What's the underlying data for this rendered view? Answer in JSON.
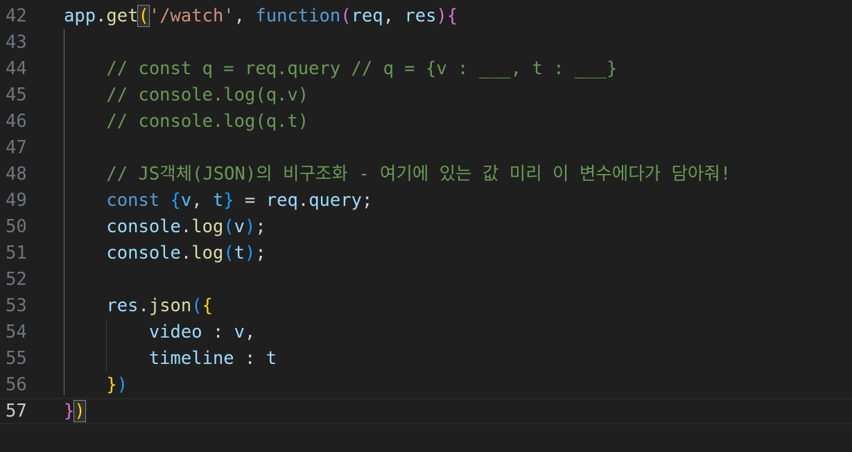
{
  "editor": {
    "language": "javascript",
    "current_line": "57",
    "lines": [
      {
        "num": "42",
        "parts": [
          {
            "t": "app",
            "c": "var"
          },
          {
            "t": ".",
            "c": "pun"
          },
          {
            "t": "get",
            "c": "fn"
          },
          {
            "t": "(",
            "c": "b1",
            "m": true
          },
          {
            "t": "'/watch'",
            "c": "str"
          },
          {
            "t": ", ",
            "c": "pun"
          },
          {
            "t": "function",
            "c": "kw"
          },
          {
            "t": "(",
            "c": "b2"
          },
          {
            "t": "req",
            "c": "var"
          },
          {
            "t": ", ",
            "c": "pun"
          },
          {
            "t": "res",
            "c": "var"
          },
          {
            "t": ")",
            "c": "b2"
          },
          {
            "t": "{",
            "c": "b2"
          }
        ]
      },
      {
        "num": "43",
        "parts": []
      },
      {
        "num": "44",
        "parts": [
          {
            "t": "    // const q = req.query // q = {v : ___, t : ___}",
            "c": "cmt"
          }
        ]
      },
      {
        "num": "45",
        "parts": [
          {
            "t": "    // console.log(q.v)",
            "c": "cmt"
          }
        ]
      },
      {
        "num": "46",
        "parts": [
          {
            "t": "    // console.log(q.t)",
            "c": "cmt"
          }
        ]
      },
      {
        "num": "47",
        "parts": []
      },
      {
        "num": "48",
        "parts": [
          {
            "t": "    // JS객체(JSON)의 비구조화 - 여기에 있는 값 미리 이 변수에다가 담아줘!",
            "c": "cmt"
          }
        ]
      },
      {
        "num": "49",
        "parts": [
          {
            "t": "    ",
            "c": "pun"
          },
          {
            "t": "const",
            "c": "kw"
          },
          {
            "t": " ",
            "c": "pun"
          },
          {
            "t": "{",
            "c": "b3"
          },
          {
            "t": "v",
            "c": "cst"
          },
          {
            "t": ", ",
            "c": "pun"
          },
          {
            "t": "t",
            "c": "cst"
          },
          {
            "t": "}",
            "c": "b3"
          },
          {
            "t": " = ",
            "c": "pun"
          },
          {
            "t": "req",
            "c": "var"
          },
          {
            "t": ".",
            "c": "pun"
          },
          {
            "t": "query",
            "c": "var"
          },
          {
            "t": ";",
            "c": "pun"
          }
        ]
      },
      {
        "num": "50",
        "parts": [
          {
            "t": "    ",
            "c": "pun"
          },
          {
            "t": "console",
            "c": "var"
          },
          {
            "t": ".",
            "c": "pun"
          },
          {
            "t": "log",
            "c": "fn"
          },
          {
            "t": "(",
            "c": "b3"
          },
          {
            "t": "v",
            "c": "var"
          },
          {
            "t": ")",
            "c": "b3"
          },
          {
            "t": ";",
            "c": "pun"
          }
        ]
      },
      {
        "num": "51",
        "parts": [
          {
            "t": "    ",
            "c": "pun"
          },
          {
            "t": "console",
            "c": "var"
          },
          {
            "t": ".",
            "c": "pun"
          },
          {
            "t": "log",
            "c": "fn"
          },
          {
            "t": "(",
            "c": "b3"
          },
          {
            "t": "t",
            "c": "var"
          },
          {
            "t": ")",
            "c": "b3"
          },
          {
            "t": ";",
            "c": "pun"
          }
        ]
      },
      {
        "num": "52",
        "parts": []
      },
      {
        "num": "53",
        "parts": [
          {
            "t": "    ",
            "c": "pun"
          },
          {
            "t": "res",
            "c": "var"
          },
          {
            "t": ".",
            "c": "pun"
          },
          {
            "t": "json",
            "c": "fn"
          },
          {
            "t": "(",
            "c": "b3"
          },
          {
            "t": "{",
            "c": "b1"
          }
        ]
      },
      {
        "num": "54",
        "parts": [
          {
            "t": "        ",
            "c": "pun"
          },
          {
            "t": "video",
            "c": "var"
          },
          {
            "t": " : ",
            "c": "pun"
          },
          {
            "t": "v",
            "c": "var"
          },
          {
            "t": ",",
            "c": "pun"
          }
        ]
      },
      {
        "num": "55",
        "parts": [
          {
            "t": "        ",
            "c": "pun"
          },
          {
            "t": "timeline",
            "c": "var"
          },
          {
            "t": " : ",
            "c": "pun"
          },
          {
            "t": "t",
            "c": "var"
          }
        ]
      },
      {
        "num": "56",
        "parts": [
          {
            "t": "    ",
            "c": "pun"
          },
          {
            "t": "}",
            "c": "b1"
          },
          {
            "t": ")",
            "c": "b3"
          }
        ]
      },
      {
        "num": "57",
        "parts": [
          {
            "t": "}",
            "c": "b2"
          },
          {
            "t": ")",
            "c": "b1",
            "m": true
          }
        ]
      }
    ]
  },
  "colors": {
    "background": "#1f1f1f",
    "line_number": "#6e7681",
    "line_number_active": "#cccccc",
    "comment": "#6a9955",
    "keyword": "#569cd6",
    "string": "#ce9178",
    "function": "#dcdcaa",
    "variable": "#9cdcfe"
  }
}
